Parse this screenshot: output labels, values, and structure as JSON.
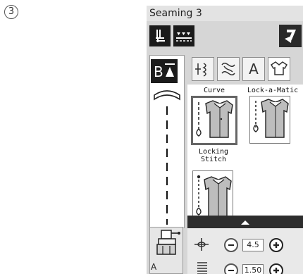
{
  "step_marker": "3",
  "title": "Seaming 3",
  "foot_letter": "A",
  "tabs": [
    {
      "icon": "stitch-pattern-icon",
      "label": "",
      "active": false
    },
    {
      "icon": "decorative-stitch-icon",
      "label": "",
      "active": false
    },
    {
      "icon": "letter-a-icon",
      "label": "A",
      "active": false
    },
    {
      "icon": "garment-icon",
      "label": "",
      "active": true
    }
  ],
  "stitches": [
    {
      "label": "Curve",
      "selected": true,
      "icon": "curve-shirt-icon"
    },
    {
      "label": "Lock-a-Matic",
      "selected": false,
      "icon": "lock-a-matic-shirt-icon"
    },
    {
      "label": "Locking\nStitch",
      "selected": false,
      "icon": "locking-stitch-shirt-icon"
    }
  ],
  "settings": [
    {
      "icon": "stitch-width-icon",
      "value": "4.5"
    },
    {
      "icon": "stitch-length-icon",
      "value": "1.50"
    }
  ]
}
